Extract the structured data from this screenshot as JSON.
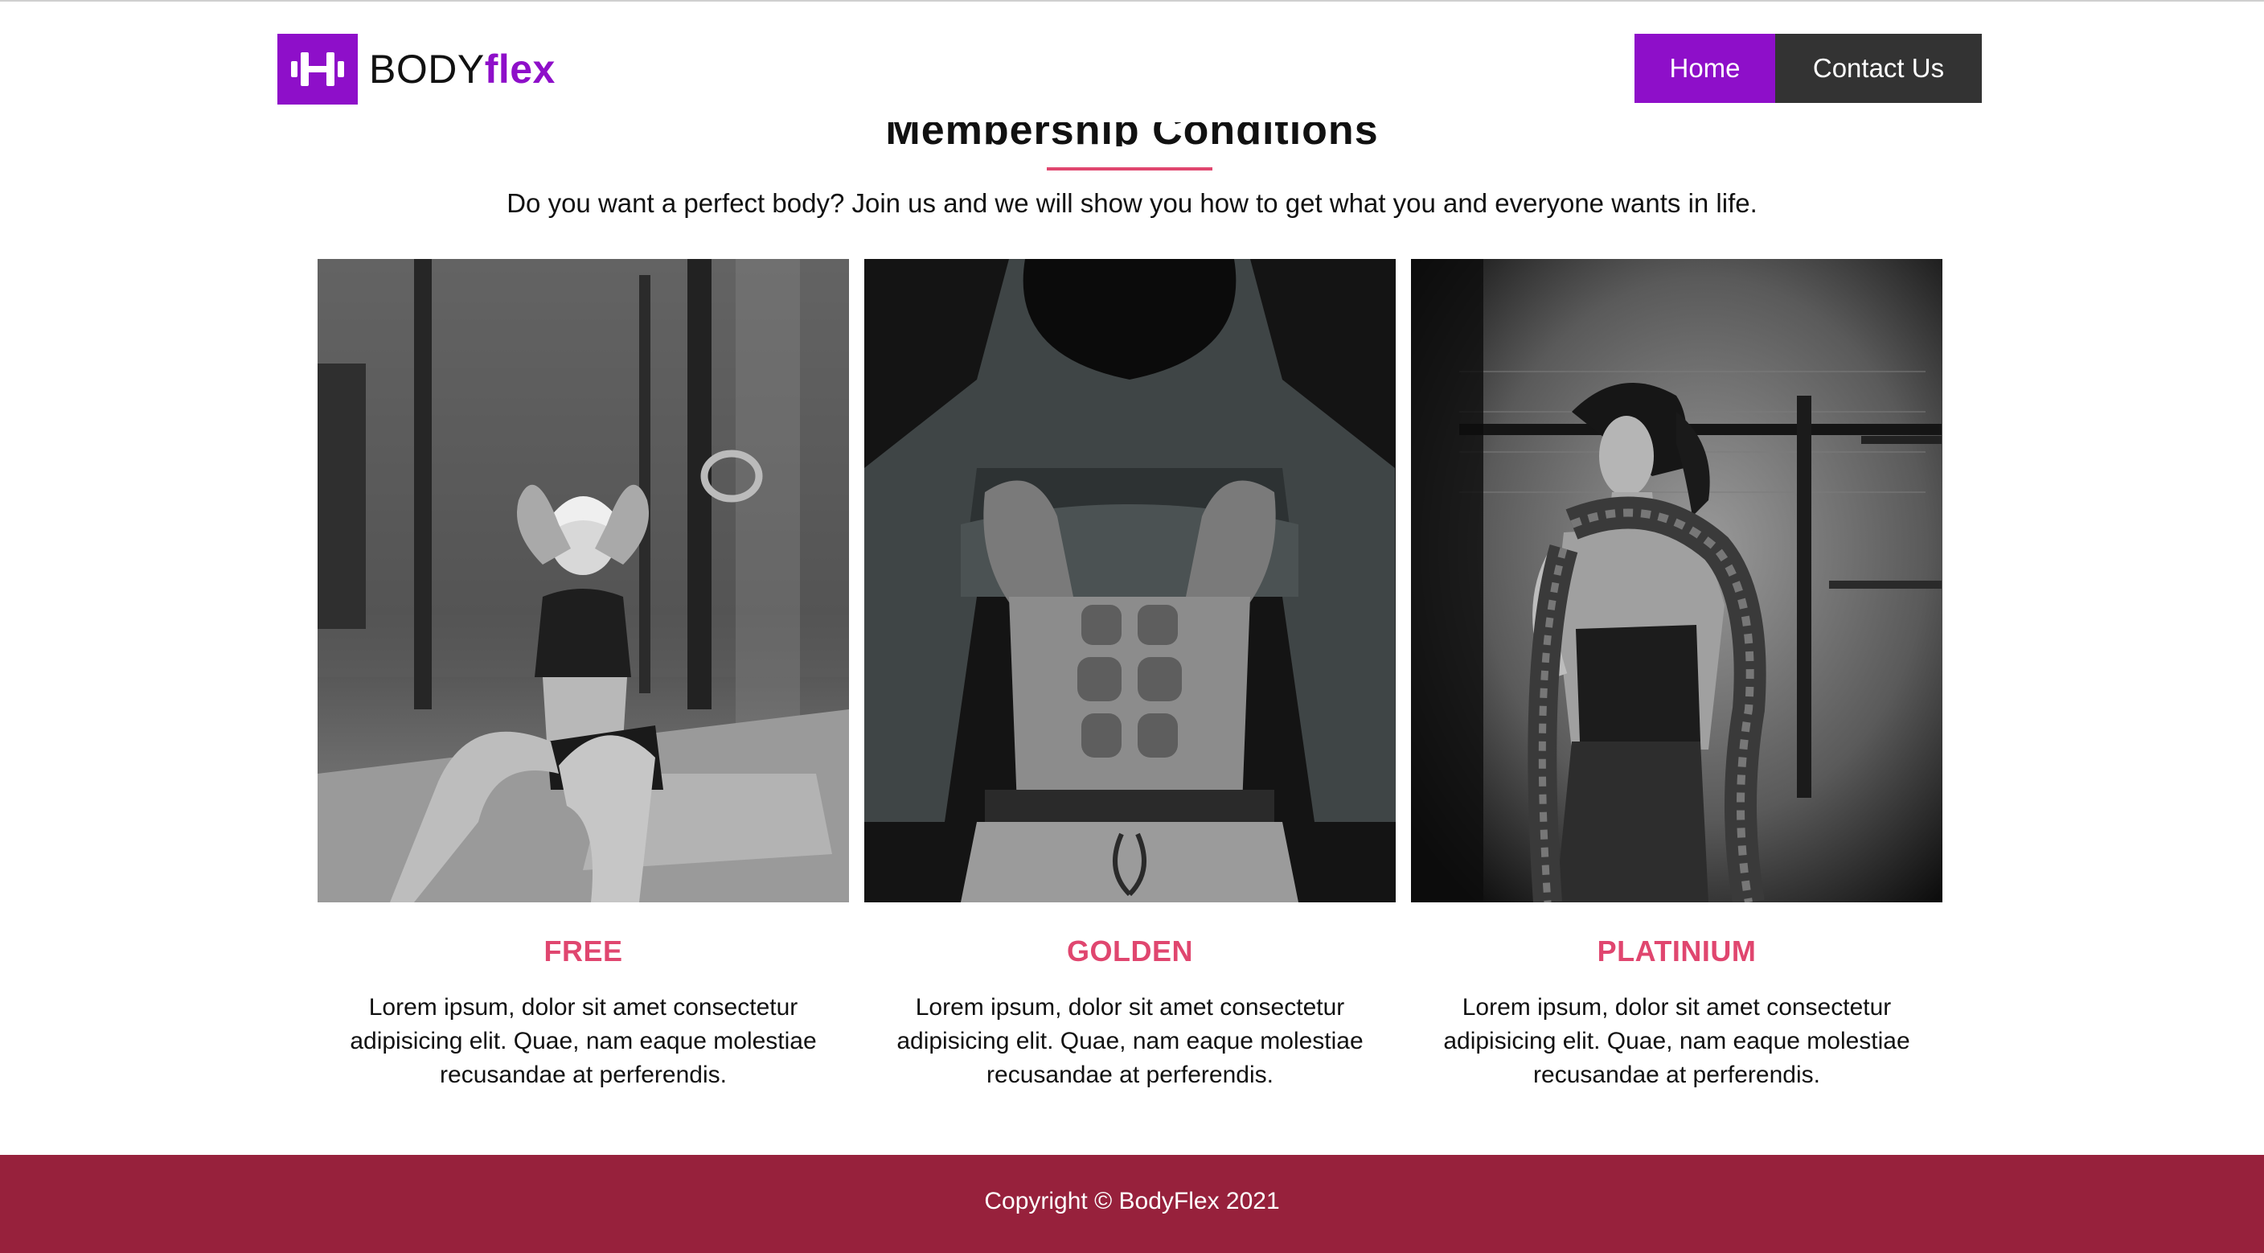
{
  "brand": {
    "name_part1": "BODY",
    "name_part2": "flex",
    "accent_color": "#8e0fc9",
    "logo_icon": "dumbbell-icon"
  },
  "nav": {
    "home_label": "Home",
    "contact_label": "Contact Us"
  },
  "section": {
    "title": "Membership Conditions",
    "intro": "Do you want a perfect body? Join us and we will show you how to get what you and everyone wants in life.",
    "underline_color": "#e0466f"
  },
  "cards": [
    {
      "title": "FREE",
      "text": "Lorem ipsum, dolor sit amet consectetur adipisicing elit. Quae, nam eaque molestiae recusandae at perferendis.",
      "image": "woman-doing-situps-photo"
    },
    {
      "title": "GOLDEN",
      "text": "Lorem ipsum, dolor sit amet consectetur adipisicing elit. Quae, nam eaque molestiae recusandae at perferendis.",
      "image": "man-showing-abs-photo"
    },
    {
      "title": "PLATINIUM",
      "text": "Lorem ipsum, dolor sit amet consectetur adipisicing elit. Quae, nam eaque molestiae recusandae at perferendis.",
      "image": "woman-with-battle-rope-photo"
    }
  ],
  "footer": {
    "copyright": "Copyright © BodyFlex 2021",
    "background_color": "#97213c"
  }
}
